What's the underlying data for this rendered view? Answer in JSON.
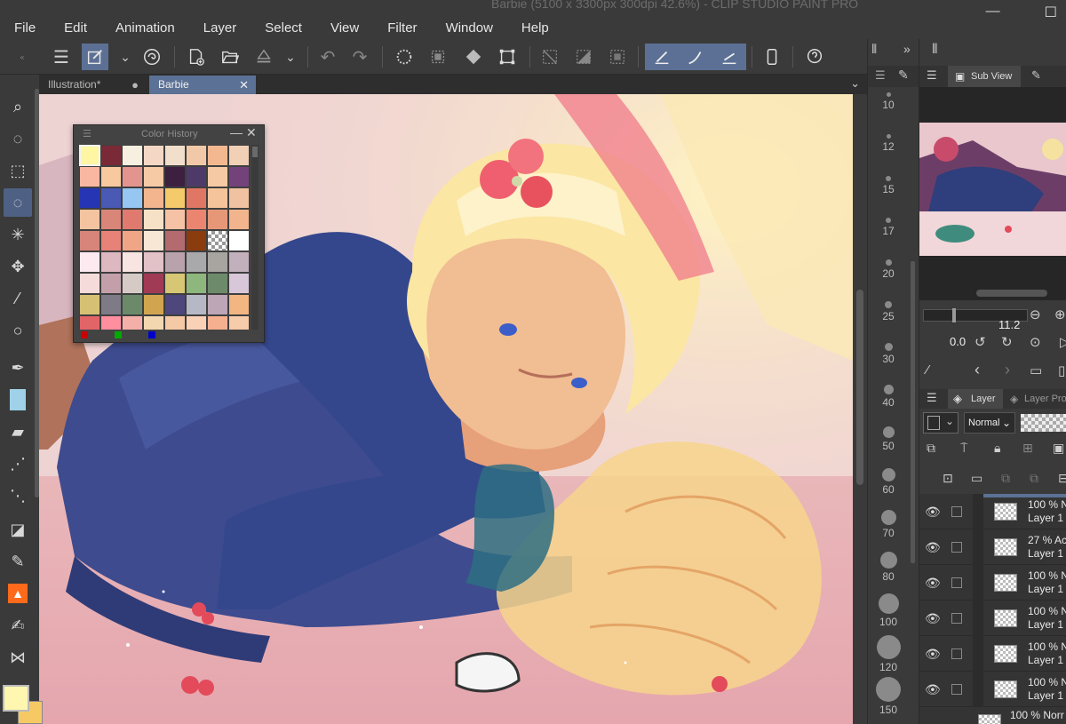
{
  "app": {
    "title": "Barbie (5100 x 3300px 300dpi 42.6%)  - CLIP STUDIO PAINT PRO",
    "window_controls": [
      "—",
      "☐"
    ]
  },
  "menu": [
    "File",
    "Edit",
    "Animation",
    "Layer",
    "Select",
    "View",
    "Filter",
    "Window",
    "Help"
  ],
  "command_bar": {
    "icons": [
      "menu-icon",
      "edit-tool-icon",
      "chevron-down-icon",
      "clip-studio-icon",
      "new-file-icon",
      "open-folder-icon",
      "save-icon",
      "chevron-down-icon",
      "undo-icon",
      "redo-icon",
      "clear-icon",
      "fill-icon",
      "transform-icon",
      "deselect-icon",
      "invert-selection-icon",
      "show-selection-icon",
      "snap-ruler-icon",
      "snap-special-ruler-icon",
      "snap-grid-icon",
      "smartphone-icon",
      "help-icon"
    ]
  },
  "tabs": [
    {
      "label": "Illustration*",
      "active": false,
      "marker": "●"
    },
    {
      "label": "Barbie",
      "active": true,
      "marker": "✕"
    }
  ],
  "tabs_dropdown": "⌄",
  "toolbar": {
    "tools": [
      "zoom-icon",
      "lasso-icon",
      "object-icon",
      "selection-icon",
      "magic-wand-icon",
      "move-icon",
      "eyedropper-icon",
      "ellipse-icon",
      "pen-icon",
      "pencil-icon",
      "brush-icon",
      "airbrush-icon",
      "spray-icon",
      "eraser-icon",
      "fill-pen-icon",
      "fill-icon",
      "blend-icon",
      "ribbon-icon"
    ],
    "active_index": 3
  },
  "color_history": {
    "title": "Color History",
    "minimize": "—",
    "close": "✕",
    "rows": [
      [
        "#fff6a3",
        "#7a2a36",
        "#f7efdf",
        "#f4d8c5",
        "#f2dfcb",
        "#f1c9a8",
        "#f4b890",
        "#f1d0b6"
      ],
      [
        "#f9b7a2",
        "#f8c89f",
        "#e4948e",
        "#f5caa5",
        "#3d2040",
        "#4e3a69",
        "#f6c9a5",
        "#74427a"
      ],
      [
        "#2535b3",
        "#4a59b4",
        "#96c6f2",
        "#f2b58e",
        "#f4ca6a",
        "#e07764",
        "#f6c49b",
        "#f0c2a1"
      ],
      [
        "#f3c49f",
        "#d98678",
        "#e07a6e",
        "#f6e0c6",
        "#f5c2a5",
        "#ec856f",
        "#e59777",
        "#f1b48d"
      ],
      [
        "#d7847a",
        "#e68277",
        "#f0a686",
        "#f8e7d5",
        "#b46b70",
        "#8b3c0e",
        "checker",
        "#ffffff"
      ],
      [
        "#fdeaf0",
        "#ddb8c1",
        "#f8e4e1",
        "#e2c1c7",
        "#b9a2ab",
        "#a9a9ac",
        "#a8a5a1",
        "#c3b0bd"
      ],
      [
        "#f5dbd9",
        "#c39fa9",
        "#d6cac7",
        "#a13b55",
        "#d7c673",
        "#8db77c",
        "#6d8b6b",
        "#d8c6d9"
      ],
      [
        "#d6c074",
        "#7e7a86",
        "#6a8a6a",
        "#d1a550",
        "#4d477c",
        "#b6b8c5",
        "#bda6b6",
        "#f2b683"
      ],
      [
        "#e26467",
        "#ff8e9e",
        "#f4b0a8",
        "#f3d7b0",
        "#f5c8a6",
        "#f9d1b7",
        "#f5b090",
        "#f7ccaa"
      ]
    ],
    "rgb_markers": [
      "#cc0000",
      "#00aa00",
      "#0000cc"
    ]
  },
  "brush_sizes": [
    "10",
    "12",
    "15",
    "17",
    "20",
    "25",
    "30",
    "40",
    "50",
    "60",
    "70",
    "80",
    "100",
    "120",
    "150"
  ],
  "subview": {
    "title": "Sub View"
  },
  "navigator": {
    "zoom": "11.2",
    "rotation": "0.0"
  },
  "layer_panel": {
    "tab_layer": "Layer",
    "tab_properties": "Layer Pro",
    "blend_mode": "Normal",
    "layers": [
      {
        "opacity": "100 % N",
        "name": "Layer 1"
      },
      {
        "opacity": "27 % Ac",
        "name": "Layer 1"
      },
      {
        "opacity": "100 % N",
        "name": "Layer 1"
      },
      {
        "opacity": "100 % N",
        "name": "Layer 1"
      },
      {
        "opacity": "100 % N",
        "name": "Layer 1"
      },
      {
        "opacity": "100 % N",
        "name": "Layer 1"
      }
    ],
    "bottom_partial": "100 % Norr"
  },
  "colors": {
    "main": "#fff7b0",
    "sub": "#f6c964",
    "accent": "#5b7195"
  }
}
